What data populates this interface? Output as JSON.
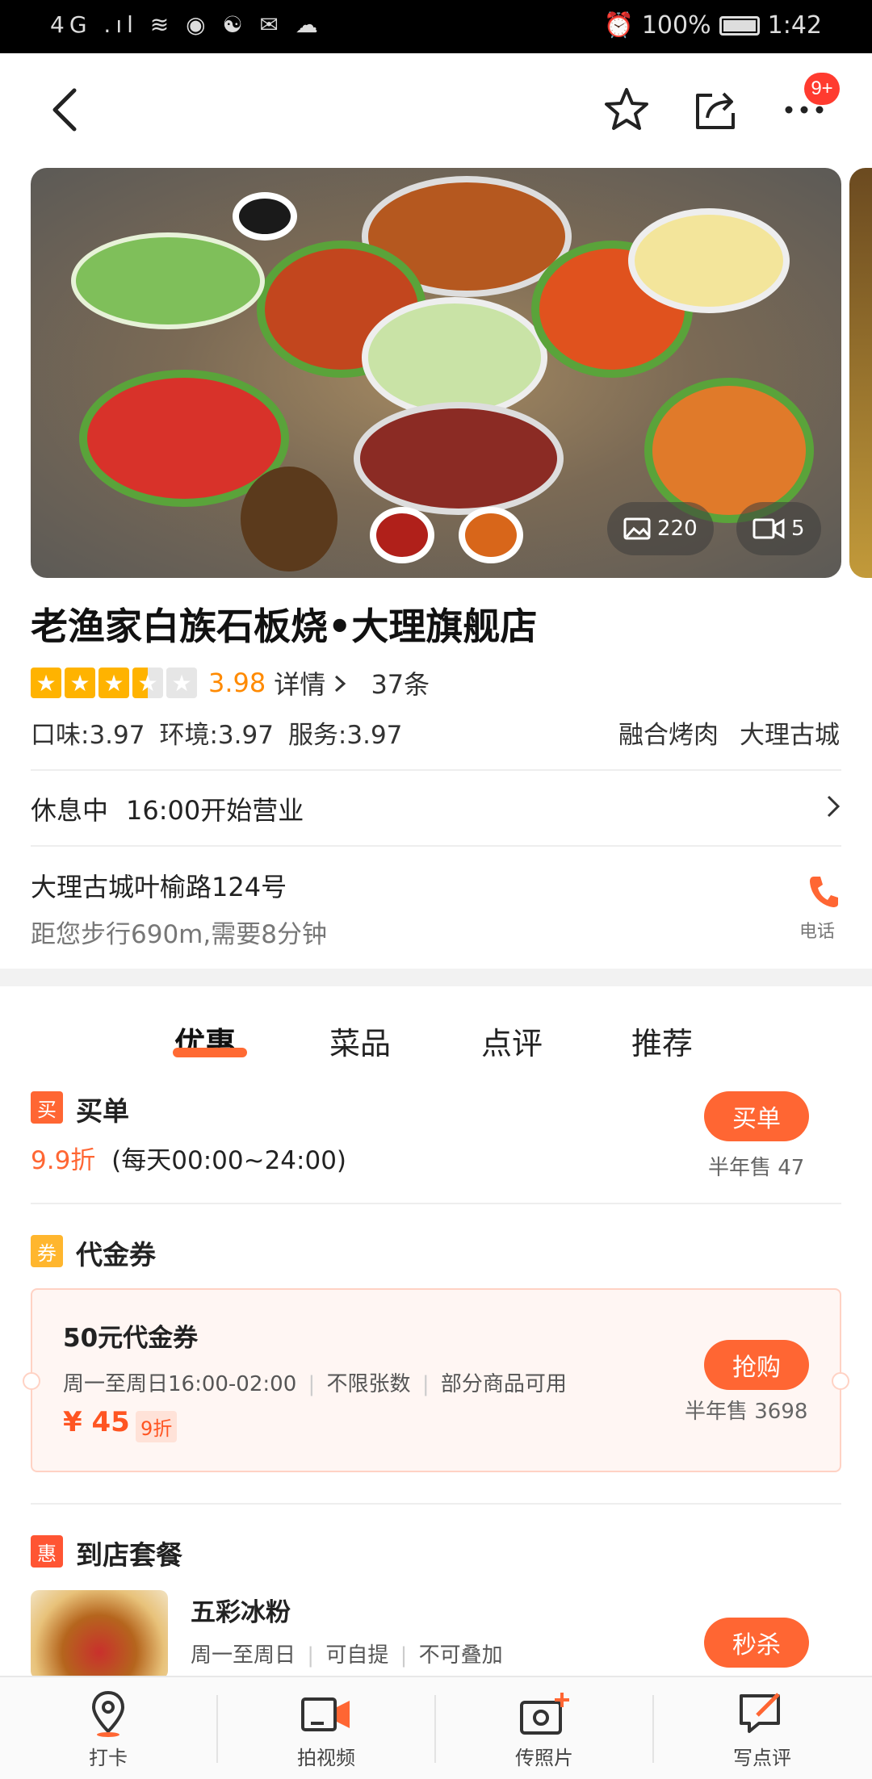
{
  "status_bar": {
    "left_icons": "4G .ıl ≋ ◉ ☯ ✉ ☁",
    "battery": "100%",
    "time": "1:42"
  },
  "nav": {
    "more_badge": "9+"
  },
  "hero": {
    "photo_count": "220",
    "video_count": "5"
  },
  "store": {
    "name": "老渔家白族石板烧•大理旗舰店",
    "score": "3.98",
    "detail_label": "详情",
    "review_count": "37条",
    "stars": 3.98,
    "taste": "口味:3.97",
    "environment": "环境:3.97",
    "service": "服务:3.97",
    "tags": [
      "融合烤肉",
      "大理古城"
    ],
    "status": "休息中",
    "open_time": "16:00开始营业",
    "address": "大理古城叶榆路124号",
    "distance": "距您步行690m,需要8分钟",
    "phone_label": "电话"
  },
  "tabs": [
    {
      "label": "优惠",
      "active": true
    },
    {
      "label": "菜品",
      "active": false
    },
    {
      "label": "点评",
      "active": false
    },
    {
      "label": "推荐",
      "active": false
    }
  ],
  "maidan": {
    "icon_text": "买",
    "title": "买单",
    "discount": "9.9折",
    "hours": "(每天00:00~24:00)",
    "button": "买单",
    "sold": "半年售 47"
  },
  "voucher": {
    "icon_text": "券",
    "section_title": "代金券",
    "name": "50元代金券",
    "terms": [
      "周一至周日16:00-02:00",
      "不限张数",
      "部分商品可用"
    ],
    "price": "¥ 45",
    "discount_tag": "9折",
    "button": "抢购",
    "sold": "半年售 3698"
  },
  "package": {
    "icon_text": "惠",
    "section_title": "到店套餐",
    "name": "五彩冰粉",
    "terms": [
      "周一至周日",
      "可自提",
      "不可叠加"
    ],
    "button": "秒杀"
  },
  "bottom_bar": [
    {
      "label": "打卡",
      "icon": "location-pin-icon"
    },
    {
      "label": "拍视频",
      "icon": "video-camera-icon"
    },
    {
      "label": "传照片",
      "icon": "photo-upload-icon"
    },
    {
      "label": "写点评",
      "icon": "write-review-icon"
    }
  ],
  "colors": {
    "accent": "#ff6633",
    "star": "#ffb300",
    "score": "#ff8a00"
  }
}
